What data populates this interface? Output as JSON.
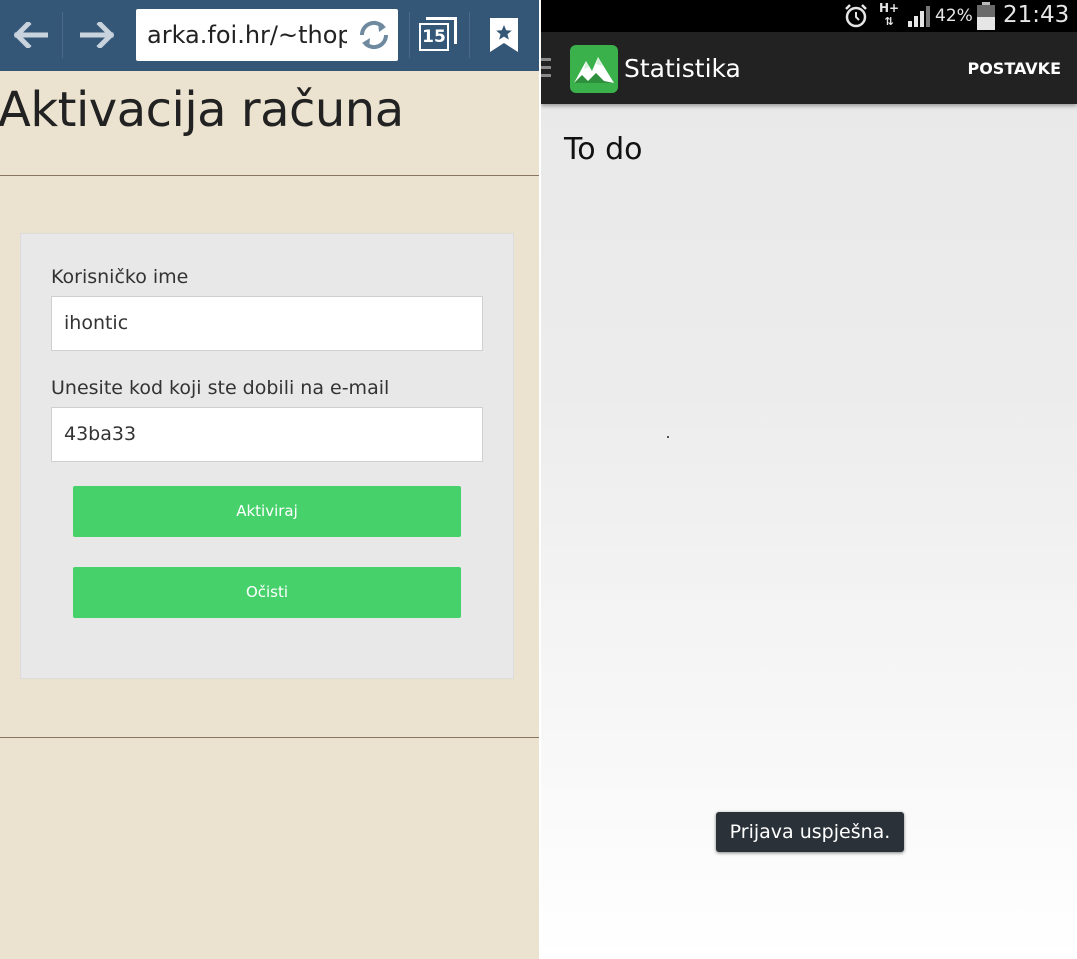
{
  "browser": {
    "url": "arka.foi.hr/~thop",
    "tab_count": "15"
  },
  "page": {
    "title": "Aktivacija računa"
  },
  "form": {
    "username_label": "Korisničko ime",
    "username_value": "ihontic",
    "code_label": "Unesite kod koji ste dobili na e-mail",
    "code_value": "43ba33",
    "activate_label": "Aktiviraj",
    "clear_label": "Očisti"
  },
  "status_bar": {
    "network": "H+",
    "battery_percent": "42%",
    "time": "21:43"
  },
  "app": {
    "title": "Statistika",
    "settings_label": "POSTAVKE",
    "content_text": "To do",
    "toast": "Prijava uspješna."
  },
  "colors": {
    "browser_bar": "#355777",
    "page_bg": "#ebe3cf",
    "button_green": "#47d16b",
    "action_bar": "#222222",
    "app_icon_green": "#3ab14b"
  }
}
